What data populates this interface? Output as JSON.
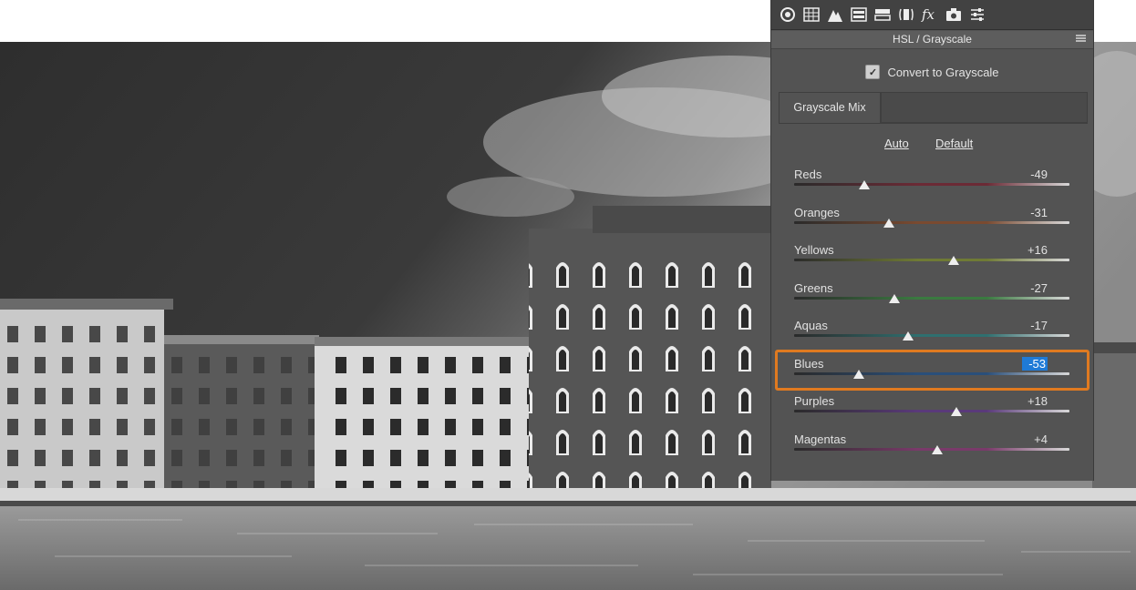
{
  "panel": {
    "title": "HSL / Grayscale",
    "toolbar_icons": [
      "basic-aperture-icon",
      "tone-curve-grid-icon",
      "detail-triangle-icon",
      "hsl-grayscale-icon",
      "split-toning-icon",
      "lens-corrections-icon",
      "fx-effects-icon",
      "camera-calibration-icon",
      "presets-sliders-icon"
    ],
    "convert_label": "Convert to Grayscale",
    "convert_checked": true,
    "tab_label": "Grayscale Mix",
    "auto_label": "Auto",
    "default_label": "Default",
    "sliders": [
      {
        "name": "Reds",
        "value": "-49",
        "track": "#6b2a35"
      },
      {
        "name": "Oranges",
        "value": "-31",
        "track": "#7a4a30"
      },
      {
        "name": "Yellows",
        "value": "+16",
        "track": "#6f7a35"
      },
      {
        "name": "Greens",
        "value": "-27",
        "track": "#3a7a40"
      },
      {
        "name": "Aquas",
        "value": "-17",
        "track": "#2f6f6f"
      },
      {
        "name": "Blues",
        "value": "-53",
        "track": "#2a4f7a"
      },
      {
        "name": "Purples",
        "value": "+18",
        "track": "#5a3a7a"
      },
      {
        "name": "Magentas",
        "value": "+4",
        "track": "#7a3a6a"
      }
    ],
    "selected_slider": "Blues"
  },
  "colors": {
    "highlight": "#e07a20",
    "selection": "#1f7ad6"
  }
}
